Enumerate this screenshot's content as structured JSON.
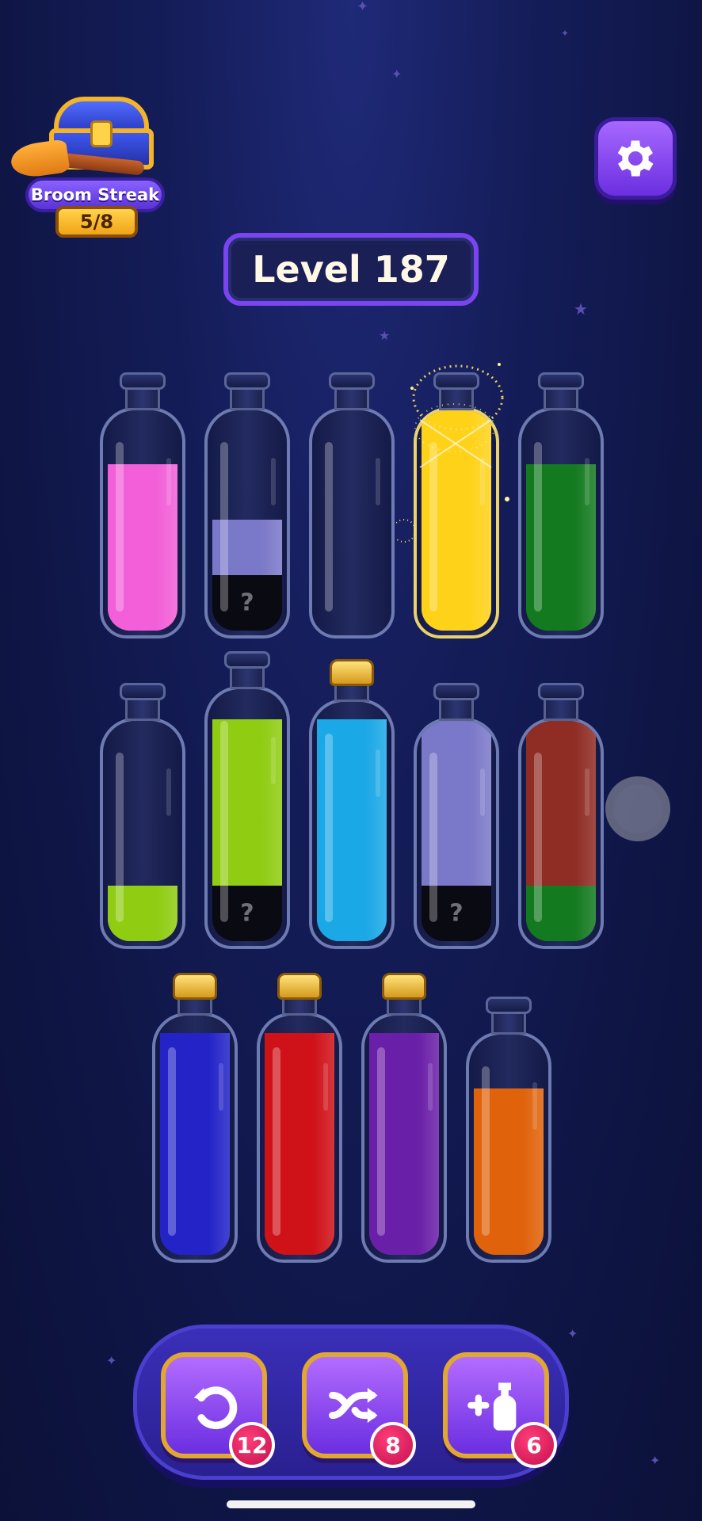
{
  "streak": {
    "title": "Broom Streak",
    "progress": "5/8"
  },
  "level": {
    "label": "Level 187"
  },
  "settings": {
    "icon": "gear-icon"
  },
  "colors": {
    "pink": "#f25fd8",
    "lavender": "#7a78c8",
    "hidden": "#0a0a12",
    "yellow": "#ffd21a",
    "green": "#137a1f",
    "lime": "#8fcc12",
    "cyan": "#1ba8e6",
    "brown": "#8f2c24",
    "blue": "#2323c8",
    "red": "#cf1218",
    "purple": "#6a1fa8",
    "orange": "#e0620a"
  },
  "bottles": [
    {
      "id": 1,
      "row": 1,
      "corked": false,
      "layers": [
        {
          "color": "pink",
          "fill": 0.75
        }
      ]
    },
    {
      "id": 2,
      "row": 1,
      "corked": false,
      "layers": [
        {
          "color": "hidden",
          "fill": 0.25,
          "label": "?"
        },
        {
          "color": "lavender",
          "fill": 0.25
        }
      ]
    },
    {
      "id": 3,
      "row": 1,
      "corked": false,
      "layers": []
    },
    {
      "id": 4,
      "row": 1,
      "corked": false,
      "selected": true,
      "layers": [
        {
          "color": "yellow",
          "fill": 1.0
        }
      ]
    },
    {
      "id": 5,
      "row": 1,
      "corked": false,
      "layers": [
        {
          "color": "green",
          "fill": 0.75
        }
      ]
    },
    {
      "id": 6,
      "row": 2,
      "corked": false,
      "layers": [
        {
          "color": "lime",
          "fill": 0.25
        }
      ]
    },
    {
      "id": 7,
      "row": 2,
      "corked": false,
      "layers": [
        {
          "color": "hidden",
          "fill": 0.25,
          "label": "?"
        },
        {
          "color": "lime",
          "fill": 0.75
        }
      ]
    },
    {
      "id": 8,
      "row": 2,
      "corked": true,
      "layers": [
        {
          "color": "cyan",
          "fill": 1.0
        }
      ]
    },
    {
      "id": 9,
      "row": 2,
      "corked": false,
      "layers": [
        {
          "color": "hidden",
          "fill": 0.25,
          "label": "?"
        },
        {
          "color": "lavender",
          "fill": 0.75
        }
      ]
    },
    {
      "id": 10,
      "row": 2,
      "corked": false,
      "layers": [
        {
          "color": "green",
          "fill": 0.25
        },
        {
          "color": "brown",
          "fill": 0.75
        }
      ]
    },
    {
      "id": 11,
      "row": 3,
      "corked": true,
      "layers": [
        {
          "color": "blue",
          "fill": 1.0
        }
      ]
    },
    {
      "id": 12,
      "row": 3,
      "corked": true,
      "layers": [
        {
          "color": "red",
          "fill": 1.0
        }
      ]
    },
    {
      "id": 13,
      "row": 3,
      "corked": true,
      "layers": [
        {
          "color": "purple",
          "fill": 1.0
        }
      ]
    },
    {
      "id": 14,
      "row": 3,
      "corked": false,
      "layers": [
        {
          "color": "orange",
          "fill": 0.75
        }
      ]
    }
  ],
  "tools": [
    {
      "name": "undo",
      "icon": "undo-icon",
      "count": "12"
    },
    {
      "name": "shuffle",
      "icon": "shuffle-icon",
      "count": "8"
    },
    {
      "name": "add-bottle",
      "icon": "add-bottle-icon",
      "count": "6"
    }
  ]
}
